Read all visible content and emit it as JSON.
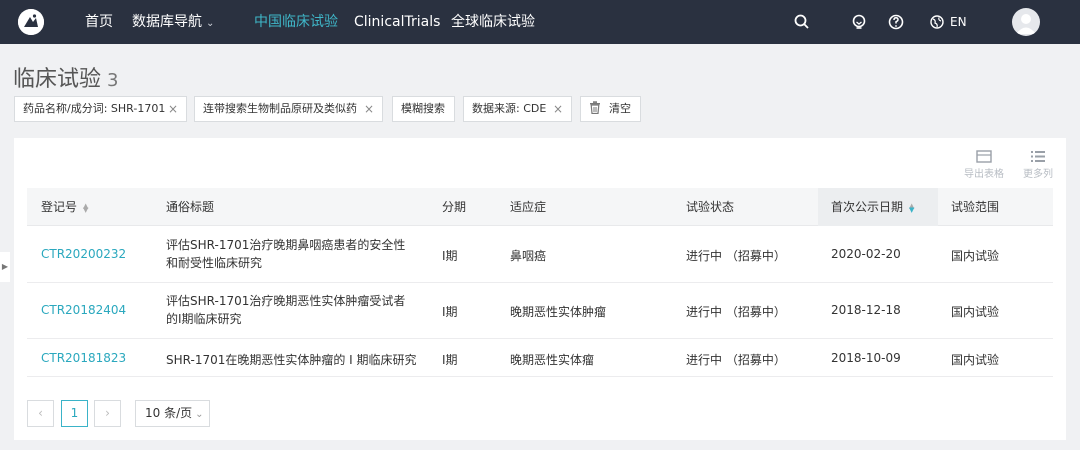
{
  "nav": {
    "items": [
      {
        "label": "首页"
      },
      {
        "label": "数据库导航"
      },
      {
        "label": "中国临床试验"
      },
      {
        "label": "ClinicalTrials"
      },
      {
        "label": "全球临床试验"
      }
    ],
    "language": "EN"
  },
  "page": {
    "title": "临床试验",
    "count": "3"
  },
  "filters": [
    {
      "label": "药品名称/成分词: SHR-1701"
    },
    {
      "label": "连带搜索生物制品原研及类似药"
    },
    {
      "label": "模糊搜索"
    },
    {
      "label": "数据来源: CDE"
    }
  ],
  "clear_label": "清空",
  "toolbar": {
    "export_label": "导出表格",
    "columns_label": "更多列"
  },
  "table": {
    "columns": [
      "登记号",
      "通俗标题",
      "分期",
      "适应症",
      "试验状态",
      "首次公示日期",
      "试验范围"
    ],
    "rows": [
      {
        "id": "CTR20200232",
        "title": "评估SHR-1701治疗晚期鼻咽癌患者的安全性和耐受性临床研究",
        "phase": "I期",
        "indication": "鼻咽癌",
        "status": "进行中 （招募中）",
        "date": "2020-02-20",
        "scope": "国内试验"
      },
      {
        "id": "CTR20182404",
        "title": "评估SHR-1701治疗晚期恶性实体肿瘤受试者的I期临床研究",
        "phase": "I期",
        "indication": "晚期恶性实体肿瘤",
        "status": "进行中 （招募中）",
        "date": "2018-12-18",
        "scope": "国内试验"
      },
      {
        "id": "CTR20181823",
        "title": "SHR-1701在晚期恶性实体肿瘤的 I 期临床研究",
        "phase": "I期",
        "indication": "晚期恶性实体瘤",
        "status": "进行中 （招募中）",
        "date": "2018-10-09",
        "scope": "国内试验"
      }
    ]
  },
  "pagination": {
    "prev": "‹",
    "current": "1",
    "next": "›",
    "page_size": "10 条/页"
  },
  "icons": {
    "search": "search-icon",
    "lightbulb": "lightbulb-icon",
    "help": "help-icon",
    "globe": "globe-icon",
    "trash": "trash-icon",
    "export": "export-table-icon",
    "columns": "list-icon"
  },
  "colors": {
    "nav_bg": "#2a3140",
    "accent": "#3ab3c8",
    "link": "#2aa8be"
  }
}
